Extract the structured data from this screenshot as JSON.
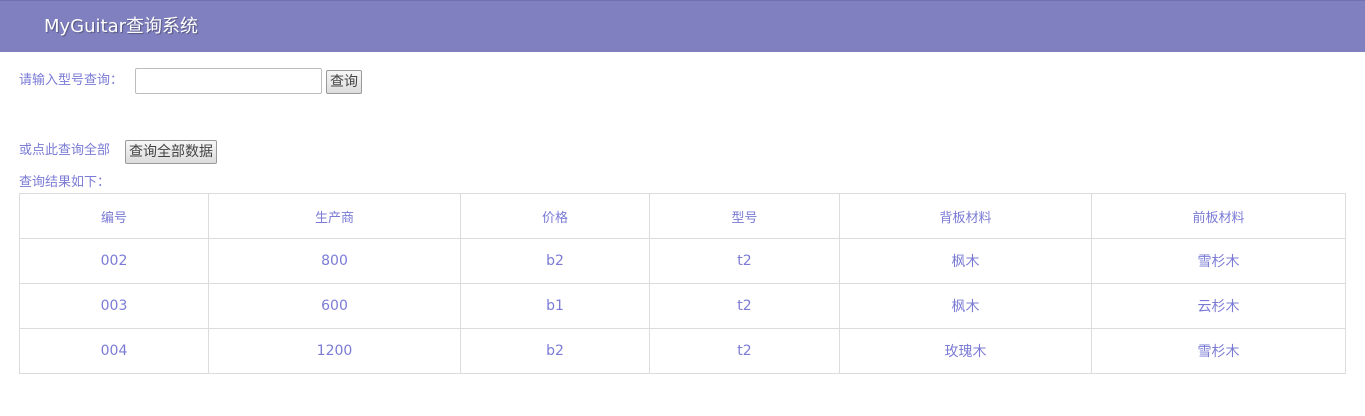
{
  "header": {
    "title": "MyGuitar查询系统"
  },
  "search": {
    "label": "请输入型号查询：",
    "input_value": "",
    "button_label": "查询"
  },
  "query_all": {
    "label": "或点此查询全部",
    "button_label": "查询全部数据"
  },
  "results": {
    "caption": "查询结果如下：",
    "columns": [
      "编号",
      "生产商",
      "价格",
      "型号",
      "背板材料",
      "前板材料"
    ],
    "rows": [
      [
        "002",
        "800",
        "b2",
        "t2",
        "枫木",
        "雪杉木"
      ],
      [
        "003",
        "600",
        "b1",
        "t2",
        "枫木",
        "云杉木"
      ],
      [
        "004",
        "1200",
        "b2",
        "t2",
        "玫瑰木",
        "雪杉木"
      ]
    ]
  },
  "colors": {
    "header_bg": "#8080c0",
    "text_accent": "#7b7bd6",
    "border": "#dcdcdc"
  }
}
